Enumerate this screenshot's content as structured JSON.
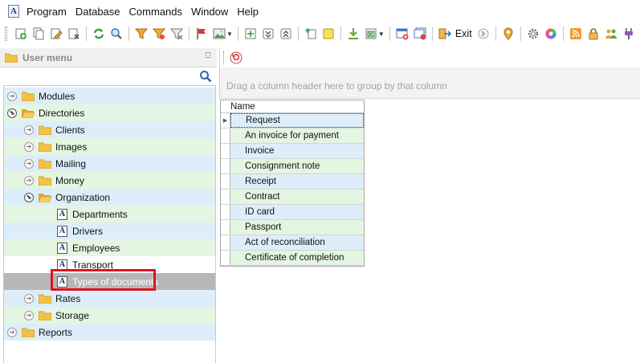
{
  "app": {
    "icon_letter": "A"
  },
  "menu": [
    "Program",
    "Database",
    "Commands",
    "Window",
    "Help"
  ],
  "toolbar": {
    "exit_label": "Exit"
  },
  "left_panel": {
    "title": "User menu",
    "pin_glyph": "⎕",
    "tree": {
      "modules": "Modules",
      "directories": "Directories",
      "clients": "Clients",
      "images": "Images",
      "mailing": "Mailing",
      "money": "Money",
      "organization": "Organization",
      "departments": "Departments",
      "drivers": "Drivers",
      "employees": "Employees",
      "transport": "Transport",
      "types_of_documents": "Types of documents",
      "rates": "Rates",
      "storage": "Storage",
      "reports": "Reports"
    },
    "doc_letter": "A"
  },
  "right_panel": {
    "group_hint": "Drag a column header here to group by that column",
    "column_header": "Name",
    "rows": [
      "Request",
      "An invoice for payment",
      "Invoice",
      "Consignment note",
      "Receipt",
      "Contract",
      "ID card",
      "Passport",
      "Act of reconciliation",
      "Certificate of completion"
    ]
  },
  "colors": {
    "row_blue": "#ddeefa",
    "row_green": "#e4f5e2",
    "selected": "#b7b7b7",
    "highlight": "#e0141e"
  }
}
